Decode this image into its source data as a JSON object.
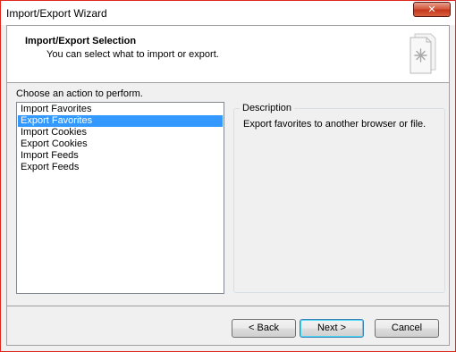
{
  "window": {
    "title": "Import/Export Wizard",
    "close_glyph": "✕"
  },
  "header": {
    "title": "Import/Export Selection",
    "subtitle": "You can select what to import or export.",
    "icon": "wizard-document-icon"
  },
  "prompt": "Choose an action to perform.",
  "actions": [
    {
      "label": "Import Favorites",
      "selected": false
    },
    {
      "label": "Export Favorites",
      "selected": true
    },
    {
      "label": "Import Cookies",
      "selected": false
    },
    {
      "label": "Export Cookies",
      "selected": false
    },
    {
      "label": "Import Feeds",
      "selected": false
    },
    {
      "label": "Export Feeds",
      "selected": false
    }
  ],
  "description": {
    "legend": "Description",
    "text": "Export favorites to another browser or file."
  },
  "buttons": {
    "back": "< Back",
    "next": "Next >",
    "cancel": "Cancel"
  },
  "colors": {
    "selection": "#3399ff",
    "window_border": "#e0271d",
    "close_button": "#c4371d"
  }
}
